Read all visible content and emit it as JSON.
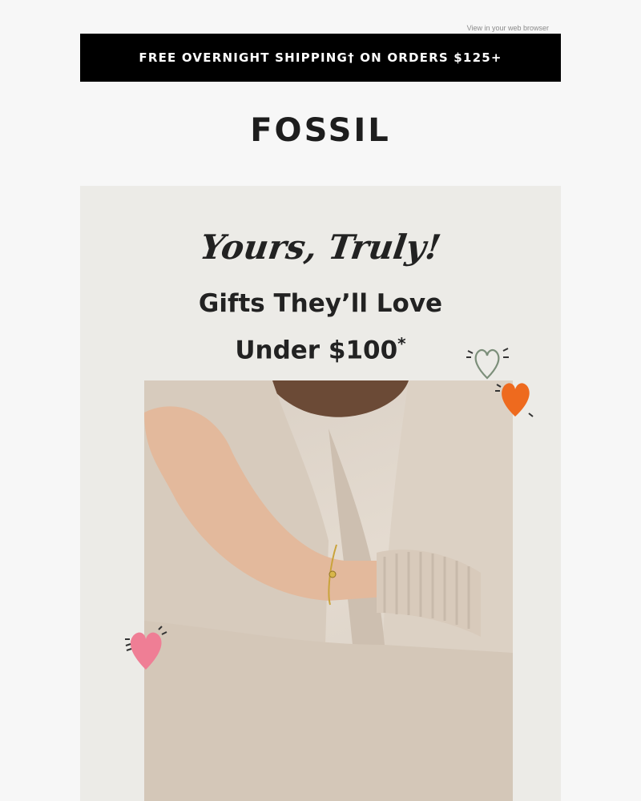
{
  "header": {
    "browser_link": "View in your web browser",
    "shipping_banner": "FREE OVERNIGHT SHIPPING† ON ORDERS $125+",
    "logo": "FOSSIL"
  },
  "hero": {
    "script_title": "Yours, Truly!",
    "headline_line1": "Gifts They’ll Love",
    "headline_line2": "Under $100",
    "headline_asterisk": "*",
    "image_alt": "Woman in a beige knit sweater wearing a gold chain bracelet"
  },
  "colors": {
    "banner_bg": "#000000",
    "hero_bg": "#ecebe7",
    "heart_orange": "#ee6a1e",
    "heart_pink": "#ef7e95",
    "heart_outline": "#7c8f7a"
  },
  "icons": [
    "heart-outline-icon",
    "heart-orange-icon",
    "heart-pink-icon"
  ]
}
